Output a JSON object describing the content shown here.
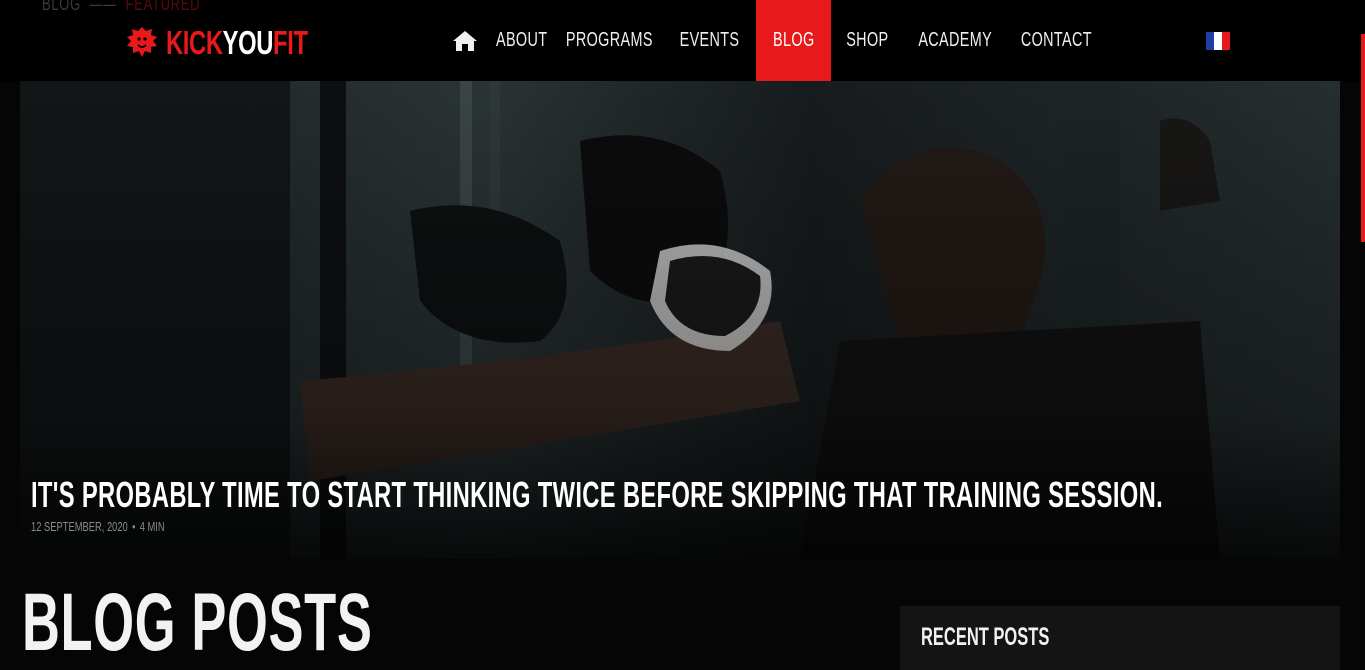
{
  "breadcrumb": {
    "parent": "Blog",
    "separator": "——",
    "current": "Featured"
  },
  "logo": {
    "part1": "KICK",
    "part2": "YOU",
    "part3": "FIT",
    "icon": "lion-head-icon"
  },
  "nav": {
    "home_icon": "home-icon",
    "items": [
      {
        "label": "About"
      },
      {
        "label": "Programs"
      },
      {
        "label": "Events"
      },
      {
        "label": "Blog",
        "active": true
      },
      {
        "label": "Shop"
      },
      {
        "label": "Academy"
      },
      {
        "label": "Contact"
      }
    ],
    "language_icon": "french-flag-icon"
  },
  "hero": {
    "title": "It's probably time to start thinking twice before skipping that training session.",
    "date": "12 September, 2020",
    "separator": "•",
    "read_time": "4 min"
  },
  "main": {
    "heading": "Blog Posts"
  },
  "sidebar": {
    "recent_title": "Recent Posts"
  },
  "colors": {
    "accent": "#e8191b",
    "background": "#050505",
    "panel": "#141414"
  }
}
